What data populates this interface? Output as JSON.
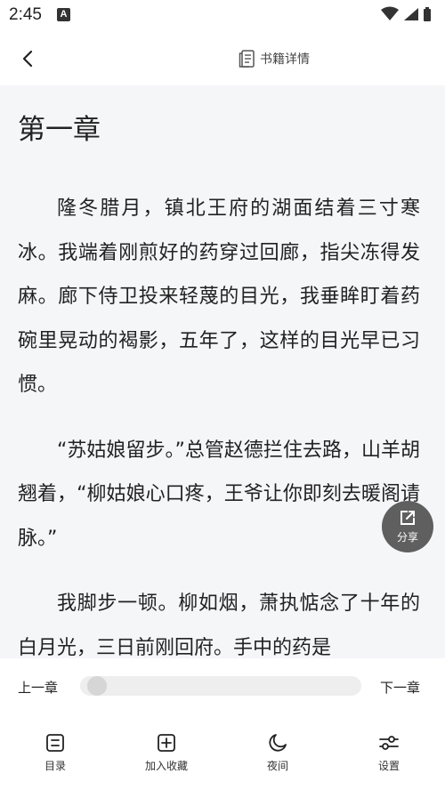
{
  "status_bar": {
    "time": "2:45",
    "notification_icon": "a-icon",
    "letter": "A"
  },
  "header": {
    "book_detail_label": "书籍详情",
    "back_icon": "chevron-left-icon",
    "detail_icon": "document-icon"
  },
  "chapter": {
    "title": "第一章",
    "paragraphs": [
      "隆冬腊月，镇北王府的湖面结着三寸寒冰。我端着刚煎好的药穿过回廊，指尖冻得发麻。廊下侍卫投来轻蔑的目光，我垂眸盯着药碗里晃动的褐影，五年了，这样的目光早已习惯。",
      "“苏姑娘留步。”总管赵德拦住去路，山羊胡翘着，“柳姑娘心口疼，王爷让你即刻去暖阁请脉。”",
      "我脚步一顿。柳如烟，萧执惦念了十年的白月光，三日前刚回府。手中的药是"
    ]
  },
  "share": {
    "label": "分享",
    "icon": "share-icon"
  },
  "progress": {
    "prev_label": "上一章",
    "next_label": "下一章",
    "value": 0
  },
  "bottom_nav": {
    "items": [
      {
        "label": "目录",
        "icon": "catalog-icon"
      },
      {
        "label": "加入收藏",
        "icon": "add-favorite-icon"
      },
      {
        "label": "夜间",
        "icon": "moon-icon"
      },
      {
        "label": "设置",
        "icon": "settings-sliders-icon"
      }
    ]
  },
  "colors": {
    "reader_background": "#f5f6f8",
    "share_button": "#5f5f5f",
    "text": "#222222"
  }
}
